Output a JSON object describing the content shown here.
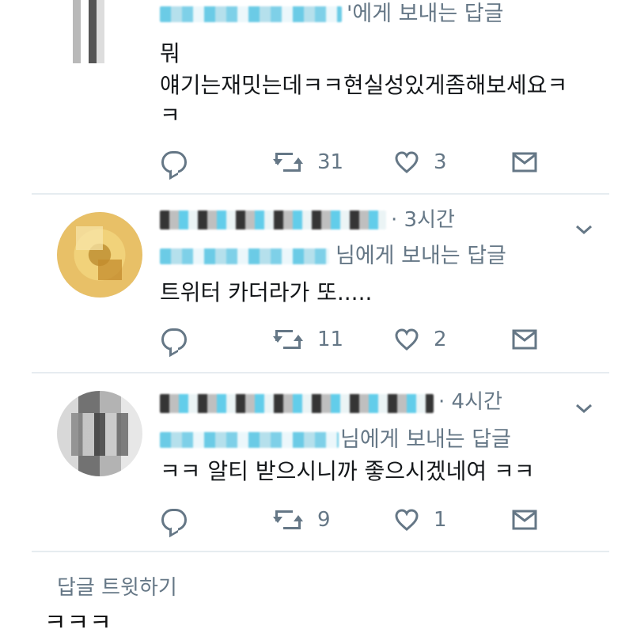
{
  "tweets": [
    {
      "reply_to_suffix": "'에게 보내는 답글",
      "lines": [
        "뭐",
        "얘기는재밋는데ㅋㅋ현실성있게좀해보세요ㅋ",
        "ㅋ"
      ],
      "retweets": "31",
      "likes": "3",
      "icons": [
        "reply-icon",
        "retweet-icon",
        "heart-icon",
        "mail-icon"
      ]
    },
    {
      "time": "· 3시간",
      "reply_to_suffix": "님에게 보내는 답글",
      "lines": [
        "트위터 카더라가 또....."
      ],
      "retweets": "11",
      "likes": "2",
      "icons": [
        "reply-icon",
        "retweet-icon",
        "heart-icon",
        "mail-icon",
        "chevron-down-icon"
      ]
    },
    {
      "time": "· 4시간",
      "reply_to_suffix": "님에게 보내는 답글",
      "lines": [
        "ㅋㅋ 알티 받으시니까 좋으시겠네여 ㅋㅋ"
      ],
      "retweets": "9",
      "likes": "1",
      "icons": [
        "reply-icon",
        "retweet-icon",
        "heart-icon",
        "mail-icon",
        "chevron-down-icon"
      ]
    }
  ],
  "compose": {
    "label": "답글 트윗하기",
    "text": "ㅋㅋㅋ"
  },
  "colors": {
    "text": "#14171a",
    "muted": "#657786",
    "divider": "#e6ecf0"
  }
}
